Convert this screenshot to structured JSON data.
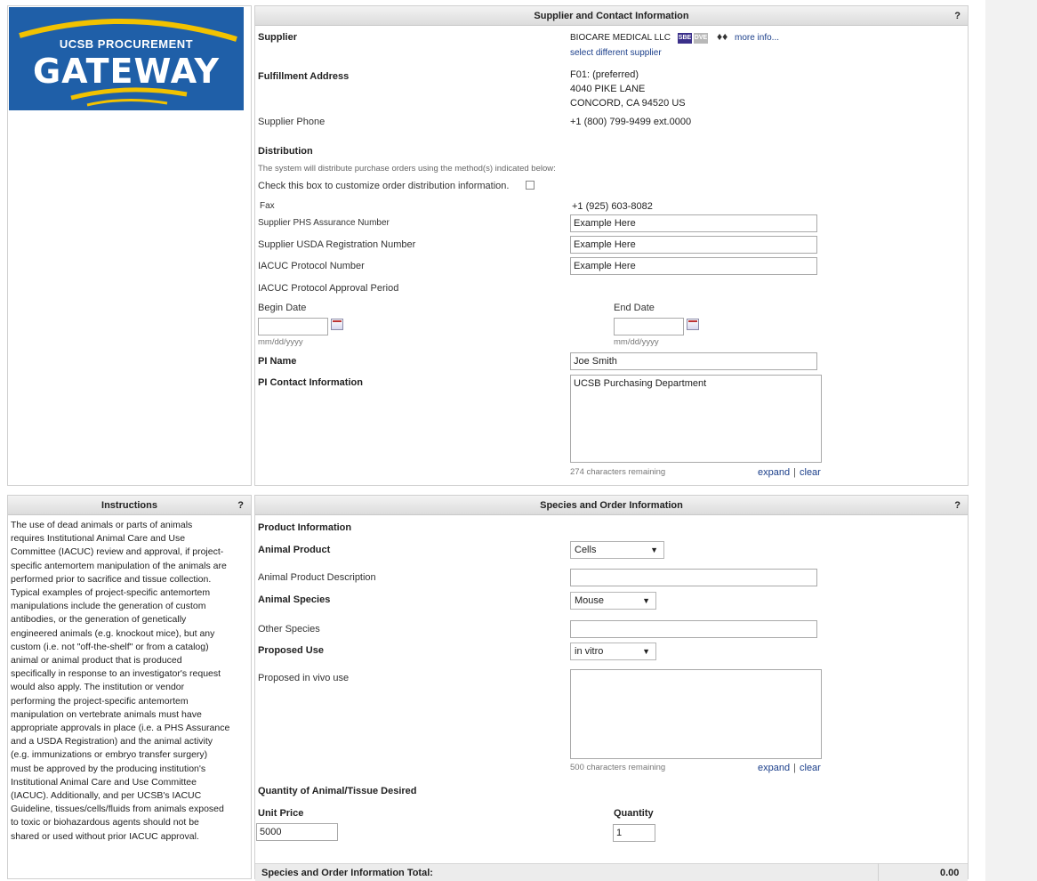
{
  "logo": {
    "line1": "UCSB PROCUREMENT",
    "line2": "GATEWAY",
    "brand_color": "#1f5fa8",
    "accent_color": "#f2c200"
  },
  "supplier_panel": {
    "title": "Supplier and Contact Information",
    "help": "?",
    "supplier_label": "Supplier",
    "supplier_name": "BIOCARE MEDICAL LLC",
    "badge_sbe": "SBE",
    "badge_dve": "DVE",
    "more_info": "more info...",
    "select_different": "select different supplier",
    "fulfillment_label": "Fulfillment Address",
    "address_line1": "F01: (preferred)",
    "address_line2": "4040 PIKE LANE",
    "address_line3": "CONCORD, CA 94520 US",
    "phone_label": "Supplier Phone",
    "phone_value": "+1 (800) 799-9499 ext.0000",
    "distribution_label": "Distribution",
    "distribution_note": "The system will distribute purchase orders using the method(s) indicated below:",
    "customize_label": "Check this box to customize order distribution information.",
    "fax_label": "Fax",
    "fax_value": "+1 (925) 603-8082",
    "phs_label": "Supplier PHS Assurance Number",
    "phs_value": "Example Here",
    "usda_label": "Supplier USDA Registration Number",
    "usda_value": "Example Here",
    "iacuc_label": "IACUC Protocol Number",
    "iacuc_value": "Example Here",
    "approval_period_label": "IACUC Protocol Approval Period",
    "begin_label": "Begin Date",
    "end_label": "End Date",
    "date_hint": "mm/dd/yyyy",
    "pi_name_label": "PI Name",
    "pi_name_value": "Joe Smith",
    "pi_contact_label": "PI Contact Information",
    "pi_contact_value": "UCSB Purchasing Department",
    "chars_remaining": "274 characters remaining",
    "expand": "expand",
    "clear": "clear"
  },
  "instructions": {
    "title": "Instructions",
    "help": "?",
    "lines": [
      "The use of dead animals or parts of animals",
      "requires Institutional Animal Care and Use",
      "Committee (IACUC) review and approval, if project-",
      "specific antemortem manipulation of the animals are",
      "performed prior to sacrifice and tissue collection.",
      "Typical examples of project-specific antemortem",
      "manipulations include the generation of custom",
      "antibodies, or the generation of genetically",
      "engineered animals (e.g. knockout mice), but any",
      "custom (i.e. not \"off-the-shelf\" or from a catalog)",
      "animal or animal product that is produced",
      "specifically in response to an investigator's request",
      "would also apply. The institution or vendor",
      "performing the project-specific antemortem",
      "manipulation on vertebrate animals must have",
      "appropriate approvals in place (i.e. a PHS Assurance",
      "and a USDA Registration) and the animal activity",
      "(e.g. immunizations or embryo transfer surgery)",
      "must be approved by the producing institution's",
      "Institutional Animal Care and Use Committee",
      "(IACUC). Additionally, and per UCSB's IACUC",
      "Guideline, tissues/cells/fluids from animals exposed",
      "to toxic or biohazardous agents should not be",
      "shared or used without prior IACUC approval."
    ]
  },
  "species_panel": {
    "title": "Species and Order Information",
    "help": "?",
    "product_info_label": "Product Information",
    "animal_product_label": "Animal Product",
    "animal_product_value": "Cells",
    "product_desc_label": "Animal Product Description",
    "product_desc_value": "",
    "animal_species_label": "Animal Species",
    "animal_species_value": "Mouse",
    "other_species_label": "Other Species",
    "other_species_value": "",
    "proposed_use_label": "Proposed Use",
    "proposed_use_value": "in vitro",
    "proposed_in_vivo_label": "Proposed in vivo use",
    "chars_remaining": "500 characters remaining",
    "expand": "expand",
    "clear": "clear",
    "quantity_section_label": "Quantity of Animal/Tissue Desired",
    "unit_price_label": "Unit Price",
    "unit_price_value": "5000",
    "quantity_label": "Quantity",
    "quantity_value": "1",
    "total_label": "Species and Order Information Total:",
    "total_value": "0.00"
  }
}
